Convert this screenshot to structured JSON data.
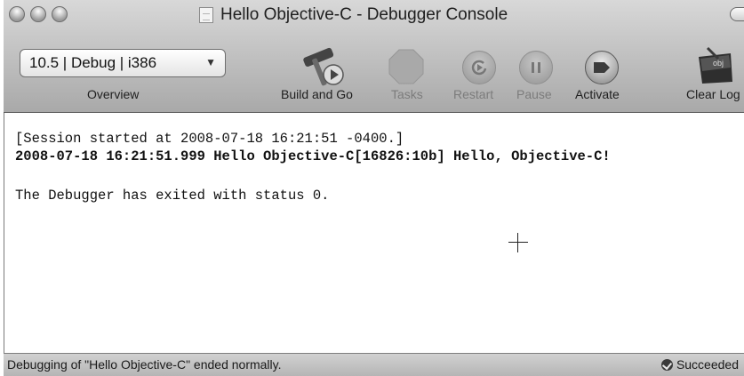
{
  "window": {
    "title": "Hello Objective-C - Debugger Console"
  },
  "toolbar": {
    "overview_value": "10.5 | Debug | i386",
    "overview_label": "Overview",
    "build_and_go_label": "Build and Go",
    "tasks_label": "Tasks",
    "restart_label": "Restart",
    "pause_label": "Pause",
    "activate_label": "Activate",
    "clear_log_label": "Clear Log",
    "icons": [
      "hammer-build-icon",
      "stop-tasks-icon",
      "restart-icon",
      "pause-icon",
      "activate-icon",
      "clear-log-icon"
    ]
  },
  "console": {
    "lines": [
      "[Session started at 2008-07-18 16:21:51 -0400.]",
      "2008-07-18 16:21:51.999 Hello Objective-C[16826:10b] Hello, Objective-C!",
      "The Debugger has exited with status 0."
    ]
  },
  "status": {
    "message": "Debugging of \"Hello Objective-C\" ended normally.",
    "result": "Succeeded"
  }
}
